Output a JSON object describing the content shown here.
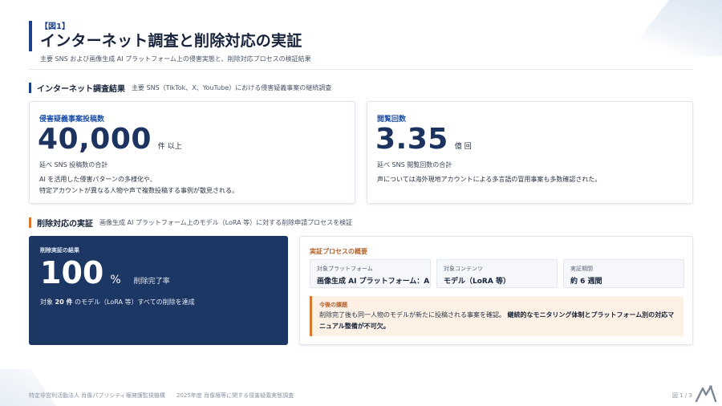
{
  "header": {
    "figure_label": "【図1】",
    "title": "インターネット調査と削除対応の実証",
    "subtitle": "主要 SNS および画像生成 AI プラットフォーム上の侵害実態と、削除対応プロセスの検証結果"
  },
  "section_survey": {
    "title": "インターネット調査結果",
    "description": "主要 SNS（TikTok、X、YouTube）における侵害疑義事案の継続調査"
  },
  "posts_card": {
    "label": "侵害疑義事案投稿数",
    "value": "40,000",
    "unit": "件 以上",
    "note": "延べ SNS 投稿数の合計",
    "desc_line1": "AI を活用した侵害パターンの多様化や、",
    "desc_line2": "特定アカウントが異なる人物や声で複数投稿する事例が散見される。"
  },
  "views_card": {
    "label": "閲覧回数",
    "value": "3.35",
    "unit": "億 回",
    "note": "延べ SNS 閲覧回数の合計",
    "desc": "声については海外現地アカウントによる多言語の冒用事案も多数確認された。"
  },
  "section_removal": {
    "title": "削除対応の実証",
    "description": "画像生成 AI プラットフォーム上のモデル（LoRA 等）に対する削除申請プロセスを検証"
  },
  "result_card": {
    "label": "削除実証の結果",
    "value": "100",
    "unit": "%",
    "caption": "削除完了率",
    "note_prefix": "対象",
    "note_count": "20 件",
    "note_suffix": "のモデル（LoRA 等）すべての削除を達成"
  },
  "process_card": {
    "title": "実証プロセスの概要",
    "items": [
      {
        "label": "対象プラットフォーム",
        "value": "画像生成 AI プラットフォーム：A"
      },
      {
        "label": "対象コンテンツ",
        "value": "モデル（LoRA 等）"
      },
      {
        "label": "実証期間",
        "value": "約 6 週間"
      }
    ],
    "issue": {
      "title": "今後の課題",
      "text_plain": "削除完了後も同一人物のモデルが新たに投稿される事案を確認。",
      "text_bold": "継続的なモニタリング体制とプラットフォーム別の対応マニュアル整備が不可欠。"
    }
  },
  "footer": {
    "org": "特定非営利活動法人 肖像パブリシティ権擁護監視機構",
    "report": "2025年度 肖像権等に関する侵害疑義実態調査",
    "page": "図 1 / 3"
  },
  "colors": {
    "accent_blue": "#1c3f8c",
    "navy_card": "#1c3763",
    "accent_orange": "#d9772f"
  },
  "icons": {
    "logo": "itmedia-logo-icon"
  }
}
